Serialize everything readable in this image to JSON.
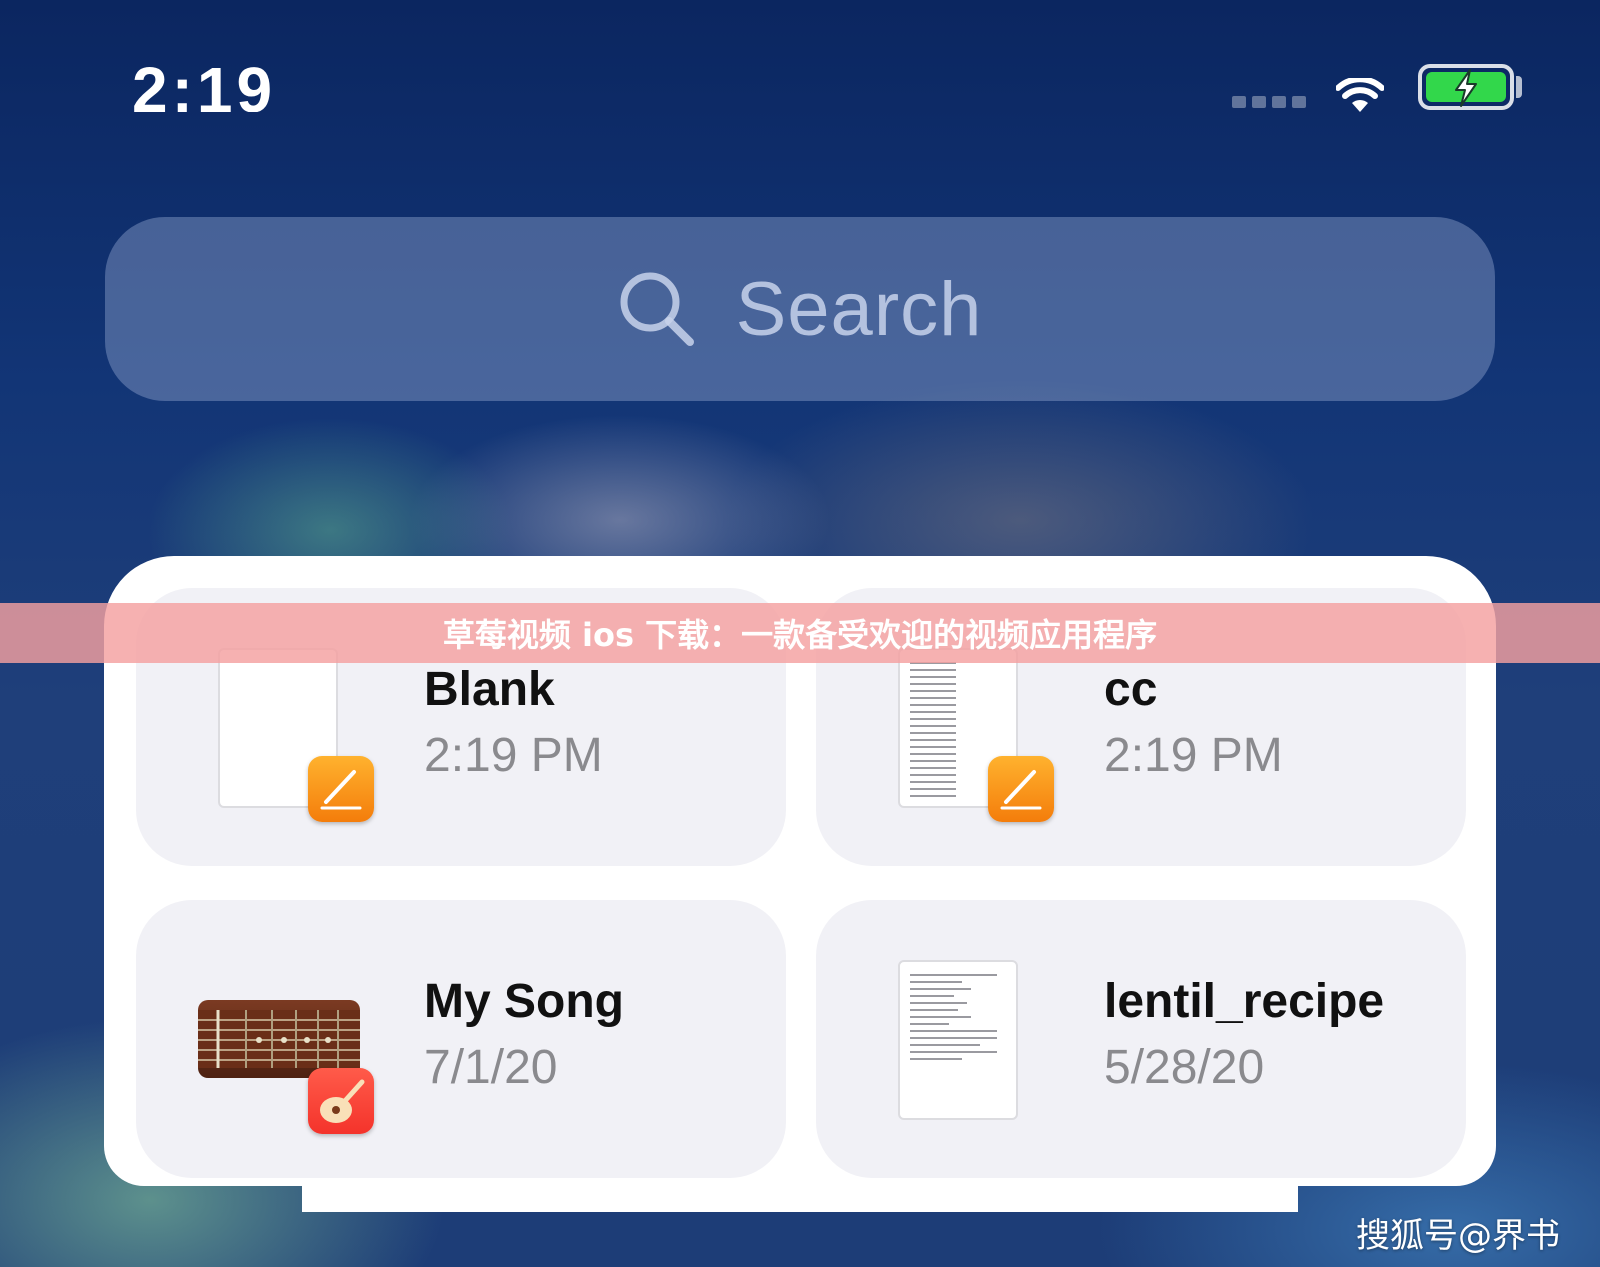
{
  "status_bar": {
    "time": "2:19",
    "battery_color": "#32d74b"
  },
  "search": {
    "placeholder": "Search",
    "icon": "search-icon"
  },
  "files": [
    {
      "name": "Blank",
      "date": "2:19 PM",
      "app": "Pages",
      "app_icon": "pages-icon",
      "thumb": "blank-document"
    },
    {
      "name": "cc",
      "date": "2:19 PM",
      "app": "Pages",
      "app_icon": "pages-icon",
      "thumb": "text-document"
    },
    {
      "name": "My Song",
      "date": "7/1/20",
      "app": "GarageBand",
      "app_icon": "garageband-icon",
      "thumb": "guitar-fretboard"
    },
    {
      "name": "lentil_recipe",
      "date": "5/28/20",
      "app": "",
      "app_icon": "",
      "thumb": "text-document"
    }
  ],
  "overlay": {
    "banner": "草莓视频 ios 下载：一款备受欢迎的视频应用程序",
    "watermark": "搜狐号@界书"
  },
  "colors": {
    "tile_bg": "#f1f1f6",
    "pages_orange": "#f89a1c",
    "garageband_red": "#f4332b",
    "banner_pink": "#f4a0a0"
  }
}
